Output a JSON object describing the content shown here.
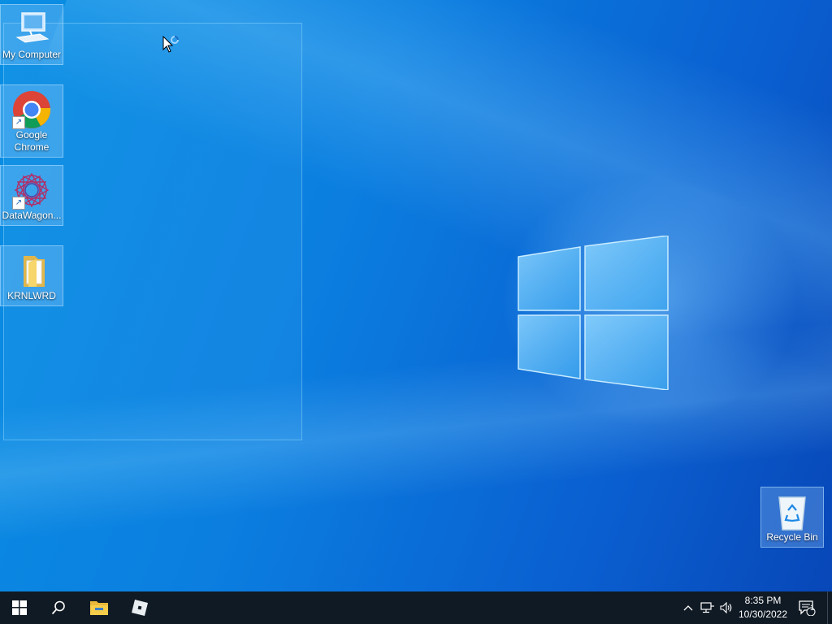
{
  "desktop": {
    "icons": [
      {
        "label": "My Computer",
        "icon": "computer-icon"
      },
      {
        "label": "Google Chrome",
        "icon": "chrome-icon"
      },
      {
        "label": "DataWagon...",
        "icon": "datawagon-icon"
      },
      {
        "label": "KRNLWRD",
        "icon": "folder-icon"
      },
      {
        "label": "Recycle Bin",
        "icon": "recycle-bin-icon"
      }
    ],
    "wallpaper_colors": {
      "top": "#0a8fe3",
      "bottom": "#0847b8"
    }
  },
  "taskbar": {
    "start": "windows-start-icon",
    "search": "search-icon",
    "pinned": [
      "file-explorer-icon",
      "roblox-icon"
    ],
    "tray": [
      "chevron-up-icon",
      "network-icon",
      "volume-icon"
    ],
    "clock": {
      "time": "8:35 PM",
      "date": "10/30/2022"
    },
    "notifications": {
      "icon": "action-center-icon",
      "count": "1"
    }
  }
}
